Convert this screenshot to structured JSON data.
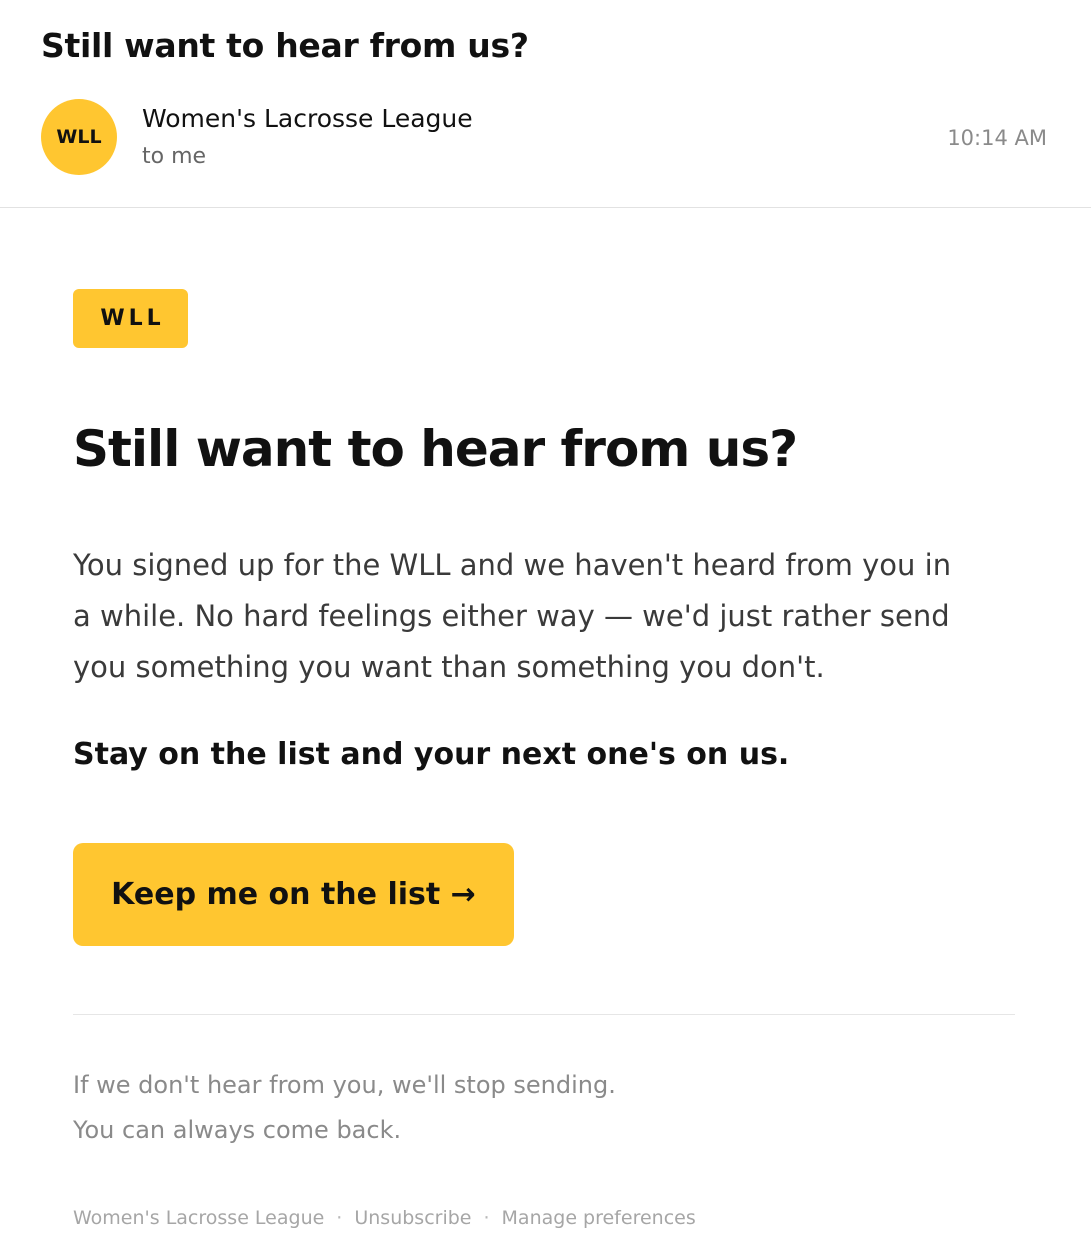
{
  "email": {
    "subject": "Still want to hear from us?",
    "sender": {
      "avatar_initials": "WLL",
      "name": "Women's Lacrosse League",
      "recipient": "to me"
    },
    "time": "10:14 AM"
  },
  "content": {
    "badge": "WLL",
    "headline": "Still want to hear from us?",
    "body": "You signed up for the WLL and we haven't heard from you in a while. No hard feelings either way — we'd just rather send you something you want than something you don't.",
    "offer": "Stay on the list and your next one's on us.",
    "cta_label": "Keep me on the list →",
    "note_line1": "If we don't hear from you, we'll stop sending.",
    "note_line2": "You can always come back."
  },
  "footer": {
    "org": "Women's Lacrosse League",
    "separator": "·",
    "unsubscribe": "Unsubscribe",
    "manage_preferences": "Manage preferences"
  },
  "colors": {
    "accent": "#FFC630",
    "text_primary": "#111111",
    "text_muted": "#8a8a8a"
  }
}
